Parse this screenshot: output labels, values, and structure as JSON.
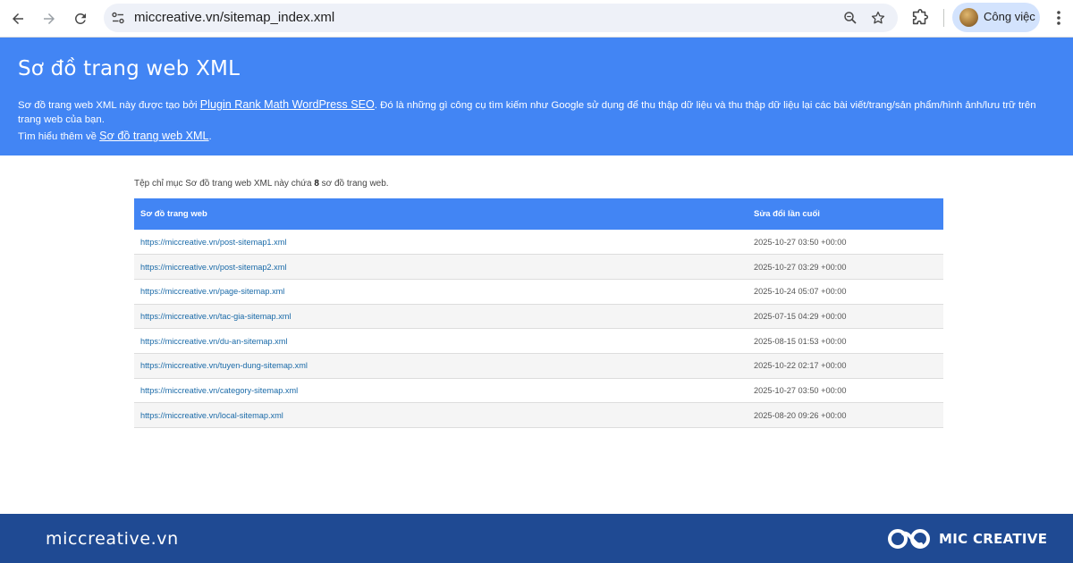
{
  "browser": {
    "url": "miccreative.vn/sitemap_index.xml",
    "profile_label": "Công việc",
    "icons": [
      "back-icon",
      "forward-icon",
      "reload-icon",
      "site-info-icon",
      "zoom-icon",
      "bookmark-star-icon",
      "extensions-icon",
      "avatar",
      "more-menu-icon"
    ]
  },
  "header": {
    "title": "Sơ đồ trang web XML",
    "intro_before": "Sơ đồ trang web XML này được tạo bởi ",
    "intro_link": "Plugin Rank Math WordPress SEO",
    "intro_after": ". Đó là những gì công cụ tìm kiếm như Google sử dụng để thu thập dữ liệu và thu thập dữ liệu lại các bài viết/trang/sản phẩm/hình ảnh/lưu trữ trên trang web của bạn.",
    "learn_before": "Tìm hiểu thêm về ",
    "learn_link": "Sơ đồ trang web XML",
    "learn_after": "."
  },
  "summary": {
    "before": "Tệp chỉ mục Sơ đồ trang web XML này chứa ",
    "count": "8",
    "after": " sơ đồ trang web."
  },
  "table": {
    "headers": [
      "Sơ đồ trang web",
      "Sửa đổi lần cuối"
    ],
    "rows": [
      {
        "url": "https://miccreative.vn/post-sitemap1.xml",
        "modified": "2025-10-27 03:50 +00:00"
      },
      {
        "url": "https://miccreative.vn/post-sitemap2.xml",
        "modified": "2025-10-27 03:29 +00:00"
      },
      {
        "url": "https://miccreative.vn/page-sitemap.xml",
        "modified": "2025-10-24 05:07 +00:00"
      },
      {
        "url": "https://miccreative.vn/tac-gia-sitemap.xml",
        "modified": "2025-07-15 04:29 +00:00"
      },
      {
        "url": "https://miccreative.vn/du-an-sitemap.xml",
        "modified": "2025-08-15 01:53 +00:00"
      },
      {
        "url": "https://miccreative.vn/tuyen-dung-sitemap.xml",
        "modified": "2025-10-22 02:17 +00:00"
      },
      {
        "url": "https://miccreative.vn/category-sitemap.xml",
        "modified": "2025-10-27 03:50 +00:00"
      },
      {
        "url": "https://miccreative.vn/local-sitemap.xml",
        "modified": "2025-08-20 09:26 +00:00"
      }
    ]
  },
  "footer": {
    "domain": "miccreative.vn",
    "brand": "MIC CREATIVE"
  },
  "colors": {
    "header_blue": "#4285f4",
    "footer_navy": "#1f4a93",
    "link": "#1a6aa8"
  }
}
